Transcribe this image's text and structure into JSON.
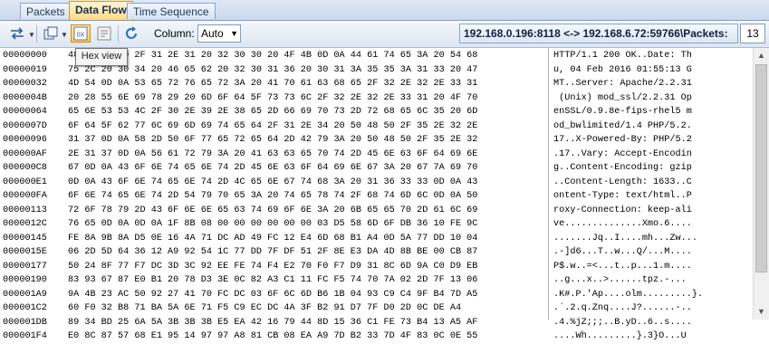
{
  "tabs": [
    "Packets",
    "Data Flow",
    "Time Sequence"
  ],
  "toolbar": {
    "column_label": "Column:",
    "column_value": "Auto",
    "hex_tooltip": "Hex view",
    "connection": "192.168.0.196:8118 <-> 192.168.6.72:59766\\Packets:",
    "packet_count": "13",
    "icons": [
      "swap-direction-icon",
      "copy-icon",
      "hex-view-icon",
      "text-view-icon",
      "refresh-icon"
    ]
  },
  "dump": {
    "offsets": [
      "00000000",
      "00000019",
      "00000032",
      "0000004B",
      "00000064",
      "0000007D",
      "00000096",
      "000000AF",
      "000000C8",
      "000000E1",
      "000000FA",
      "00000113",
      "0000012C",
      "00000145",
      "0000015E",
      "00000177",
      "00000190",
      "000001A9",
      "000001C2",
      "000001DB",
      "000001F4"
    ],
    "hex": [
      "48 54 54 50 2F 31 2E 31 20 32 30 30 20 4F 4B 0D 0A 44 61 74 65 3A 20 54 68",
      "75 2C 20 30 34 20 46 65 62 20 32 30 31 36 20 30 31 3A 35 35 3A 31 33 20 47",
      "4D 54 0D 0A 53 65 72 76 65 72 3A 20 41 70 61 63 68 65 2F 32 2E 32 2E 33 31",
      "20 28 55 6E 69 78 29 20 6D 6F 64 5F 73 73 6C 2F 32 2E 32 2E 33 31 20 4F 70",
      "65 6E 53 53 4C 2F 30 2E 39 2E 38 65 2D 66 69 70 73 2D 72 68 65 6C 35 20 6D",
      "6F 64 5F 62 77 6C 69 6D 69 74 65 64 2F 31 2E 34 20 50 48 50 2F 35 2E 32 2E",
      "31 37 0D 0A 58 2D 50 6F 77 65 72 65 64 2D 42 79 3A 20 50 48 50 2F 35 2E 32",
      "2E 31 37 0D 0A 56 61 72 79 3A 20 41 63 63 65 70 74 2D 45 6E 63 6F 64 69 6E",
      "67 0D 0A 43 6F 6E 74 65 6E 74 2D 45 6E 63 6F 64 69 6E 67 3A 20 67 7A 69 70",
      "0D 0A 43 6F 6E 74 65 6E 74 2D 4C 65 6E 67 74 68 3A 20 31 36 33 33 0D 0A 43",
      "6F 6E 74 65 6E 74 2D 54 79 70 65 3A 20 74 65 78 74 2F 68 74 6D 6C 0D 0A 50",
      "72 6F 78 79 2D 43 6F 6E 6E 65 63 74 69 6F 6E 3A 20 6B 65 65 70 2D 61 6C 69",
      "76 65 0D 0A 0D 0A 1F 8B 08 00 00 00 00 00 00 03 D5 58 6D 6F DB 36 10 FE 9C",
      "FE 8A 9B 8A D5 0E 16 4A 71 DC AD 49 FC 12 E4 6D 68 B1 A4 0D 5A 77 DD 10 04",
      "06 2D 5D 64 36 12 A9 92 54 1C 77 DD 7F DF 51 2F 8E E3 DA 4D 8B BE 00 CB 87",
      "50 24 8F 77 F7 DC 3D 3C 92 EE FE 74 F4 E2 70 F0 F7 D9 31 8C 6D 9A C0 D9 EB",
      "83 93 67 87 E0 B1 20 78 D3 3E 0C 82 A3 C1 11 FC F5 74 70 7A 02 2D 7F 13 06",
      "9A 4B 23 AC 50 92 27 41 70 FC DC 03 6F 6C 6D B6 1B 04 93 C9 C4 9F B4 7D A5",
      "60 F0 32 B8 71 BA 5A 6E 71 F5 C9 EC DC 4A 3F B2 91 D7 7F D0 2D 0C DE A4",
      "89 34 BD 25 6A 5A 3B 3B 3B E5 EA 42 16 79 44 8D 15 36 C1 FE 73 B4 13 A5 AF",
      "E0 8C 87 57 68 E1 95 14 97 97 A8 81 CB 08 EA A9 7D B2 33 7D 4F 83 0C 0E 55"
    ],
    "ascii": [
      "HTTP/1.1 200 OK..Date: Th",
      "u, 04 Feb 2016 01:55:13 G",
      "MT..Server: Apache/2.2.31",
      " (Unix) mod_ssl/2.2.31 Op",
      "enSSL/0.9.8e-fips-rhel5 m",
      "od_bwlimited/1.4 PHP/5.2.",
      "17..X-Powered-By: PHP/5.2",
      ".17..Vary: Accept-Encodin",
      "g..Content-Encoding: gzip",
      "..Content-Length: 1633..C",
      "ontent-Type: text/html..P",
      "roxy-Connection: keep-ali",
      "ve..............Xmo.6....",
      ".......Jq..I....mh...Zw...",
      ".-]d6...T..w...Q/...M....",
      "P$.w..=<...t..p...1.m....",
      "..g...x..>......tpz.-...",
      ".K#.P.'Ap....olm.........}.",
      ".`.2.q.Znq....J?......-..",
      ".4.%jZ;;;..B.yD..6..s....",
      "....Wh.........}.3}O...U"
    ]
  }
}
